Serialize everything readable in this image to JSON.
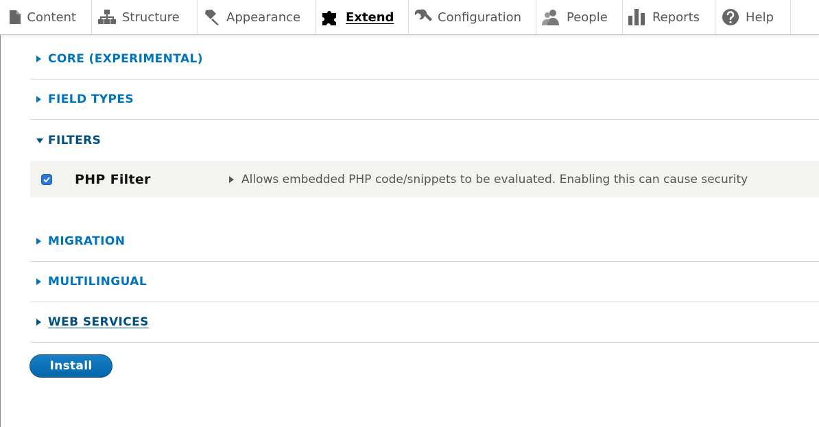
{
  "toolbar": {
    "tabs": [
      {
        "label": "Content",
        "icon": "page-icon"
      },
      {
        "label": "Structure",
        "icon": "sitemap-icon"
      },
      {
        "label": "Appearance",
        "icon": "paint-icon"
      },
      {
        "label": "Extend",
        "icon": "puzzle-icon"
      },
      {
        "label": "Configuration",
        "icon": "wrench-icon"
      },
      {
        "label": "People",
        "icon": "people-icon"
      },
      {
        "label": "Reports",
        "icon": "bar-chart-icon"
      },
      {
        "label": "Help",
        "icon": "help-icon"
      }
    ],
    "active_tab": "Extend"
  },
  "packages": [
    {
      "title": "CORE (EXPERIMENTAL)",
      "expanded": false
    },
    {
      "title": "FIELD TYPES",
      "expanded": false
    },
    {
      "title": "FILTERS",
      "expanded": true
    },
    {
      "title": "MIGRATION",
      "expanded": false
    },
    {
      "title": "MULTILINGUAL",
      "expanded": false
    },
    {
      "title": "WEB SERVICES",
      "expanded": false
    }
  ],
  "filters_modules": [
    {
      "name": "PHP Filter",
      "checked": true,
      "description": "Allows embedded PHP code/snippets to be evaluated. Enabling this can cause security"
    }
  ],
  "actions": {
    "install_label": "Install"
  },
  "colors": {
    "link": "#0074bd",
    "link_active": "#004f80",
    "button": "#0071b8",
    "row_bg": "#f3f3ef"
  }
}
